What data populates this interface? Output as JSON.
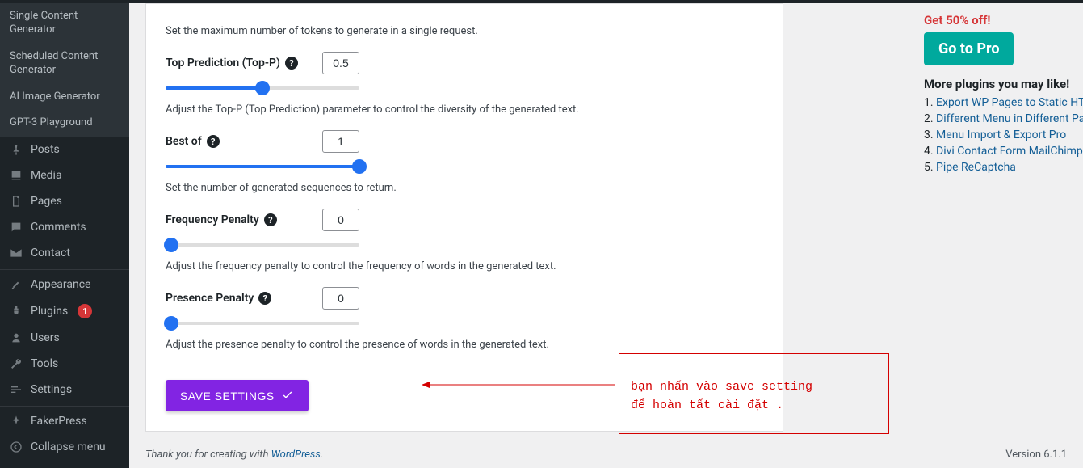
{
  "sidebar": {
    "sub": [
      "Single Content Generator",
      "Scheduled Content Generator",
      "AI Image Generator",
      "GPT-3 Playground"
    ],
    "items": [
      {
        "label": "Posts",
        "icon": "pin"
      },
      {
        "label": "Media",
        "icon": "media"
      },
      {
        "label": "Pages",
        "icon": "page"
      },
      {
        "label": "Comments",
        "icon": "comment"
      },
      {
        "label": "Contact",
        "icon": "mail"
      },
      {
        "label": "Appearance",
        "icon": "brush",
        "sep": true
      },
      {
        "label": "Plugins",
        "icon": "plug",
        "badge": "1"
      },
      {
        "label": "Users",
        "icon": "user"
      },
      {
        "label": "Tools",
        "icon": "wrench"
      },
      {
        "label": "Settings",
        "icon": "sliders"
      },
      {
        "label": "FakerPress",
        "icon": "spark",
        "sep": true
      },
      {
        "label": "Collapse menu",
        "icon": "collapse"
      }
    ]
  },
  "settings": {
    "max_tokens_desc": "Set the maximum number of tokens to generate in a single request.",
    "top_p": {
      "label": "Top Prediction (Top-P)",
      "value": "0.5",
      "slider": 50,
      "desc": "Adjust the Top-P (Top Prediction) parameter to control the diversity of the generated text."
    },
    "best_of": {
      "label": "Best of",
      "value": "1",
      "slider": 100,
      "desc": "Set the number of generated sequences to return."
    },
    "freq": {
      "label": "Frequency Penalty",
      "value": "0",
      "slider": 0,
      "desc": "Adjust the frequency penalty to control the frequency of words in the generated text."
    },
    "pres": {
      "label": "Presence Penalty",
      "value": "0",
      "slider": 0,
      "desc": "Adjust the presence penalty to control the presence of words in the generated text."
    },
    "save": "SAVE SETTINGS"
  },
  "right": {
    "off": "Get 50% off!",
    "go": "Go to Pro",
    "more": "More plugins you may like!",
    "plugins": [
      "Export WP Pages to Static HTML/CSS",
      "Different Menu in Different Pages",
      "Menu Import & Export Pro",
      "Divi Contact Form MailChimp Extension",
      "Pipe ReCaptcha"
    ]
  },
  "annotation": {
    "line1": "bạn nhấn vào save setting",
    "line2": "để hoàn tất cài đặt  ."
  },
  "footer": {
    "text": "Thank you for creating with ",
    "link": "WordPress",
    "version": "Version 6.1.1"
  }
}
